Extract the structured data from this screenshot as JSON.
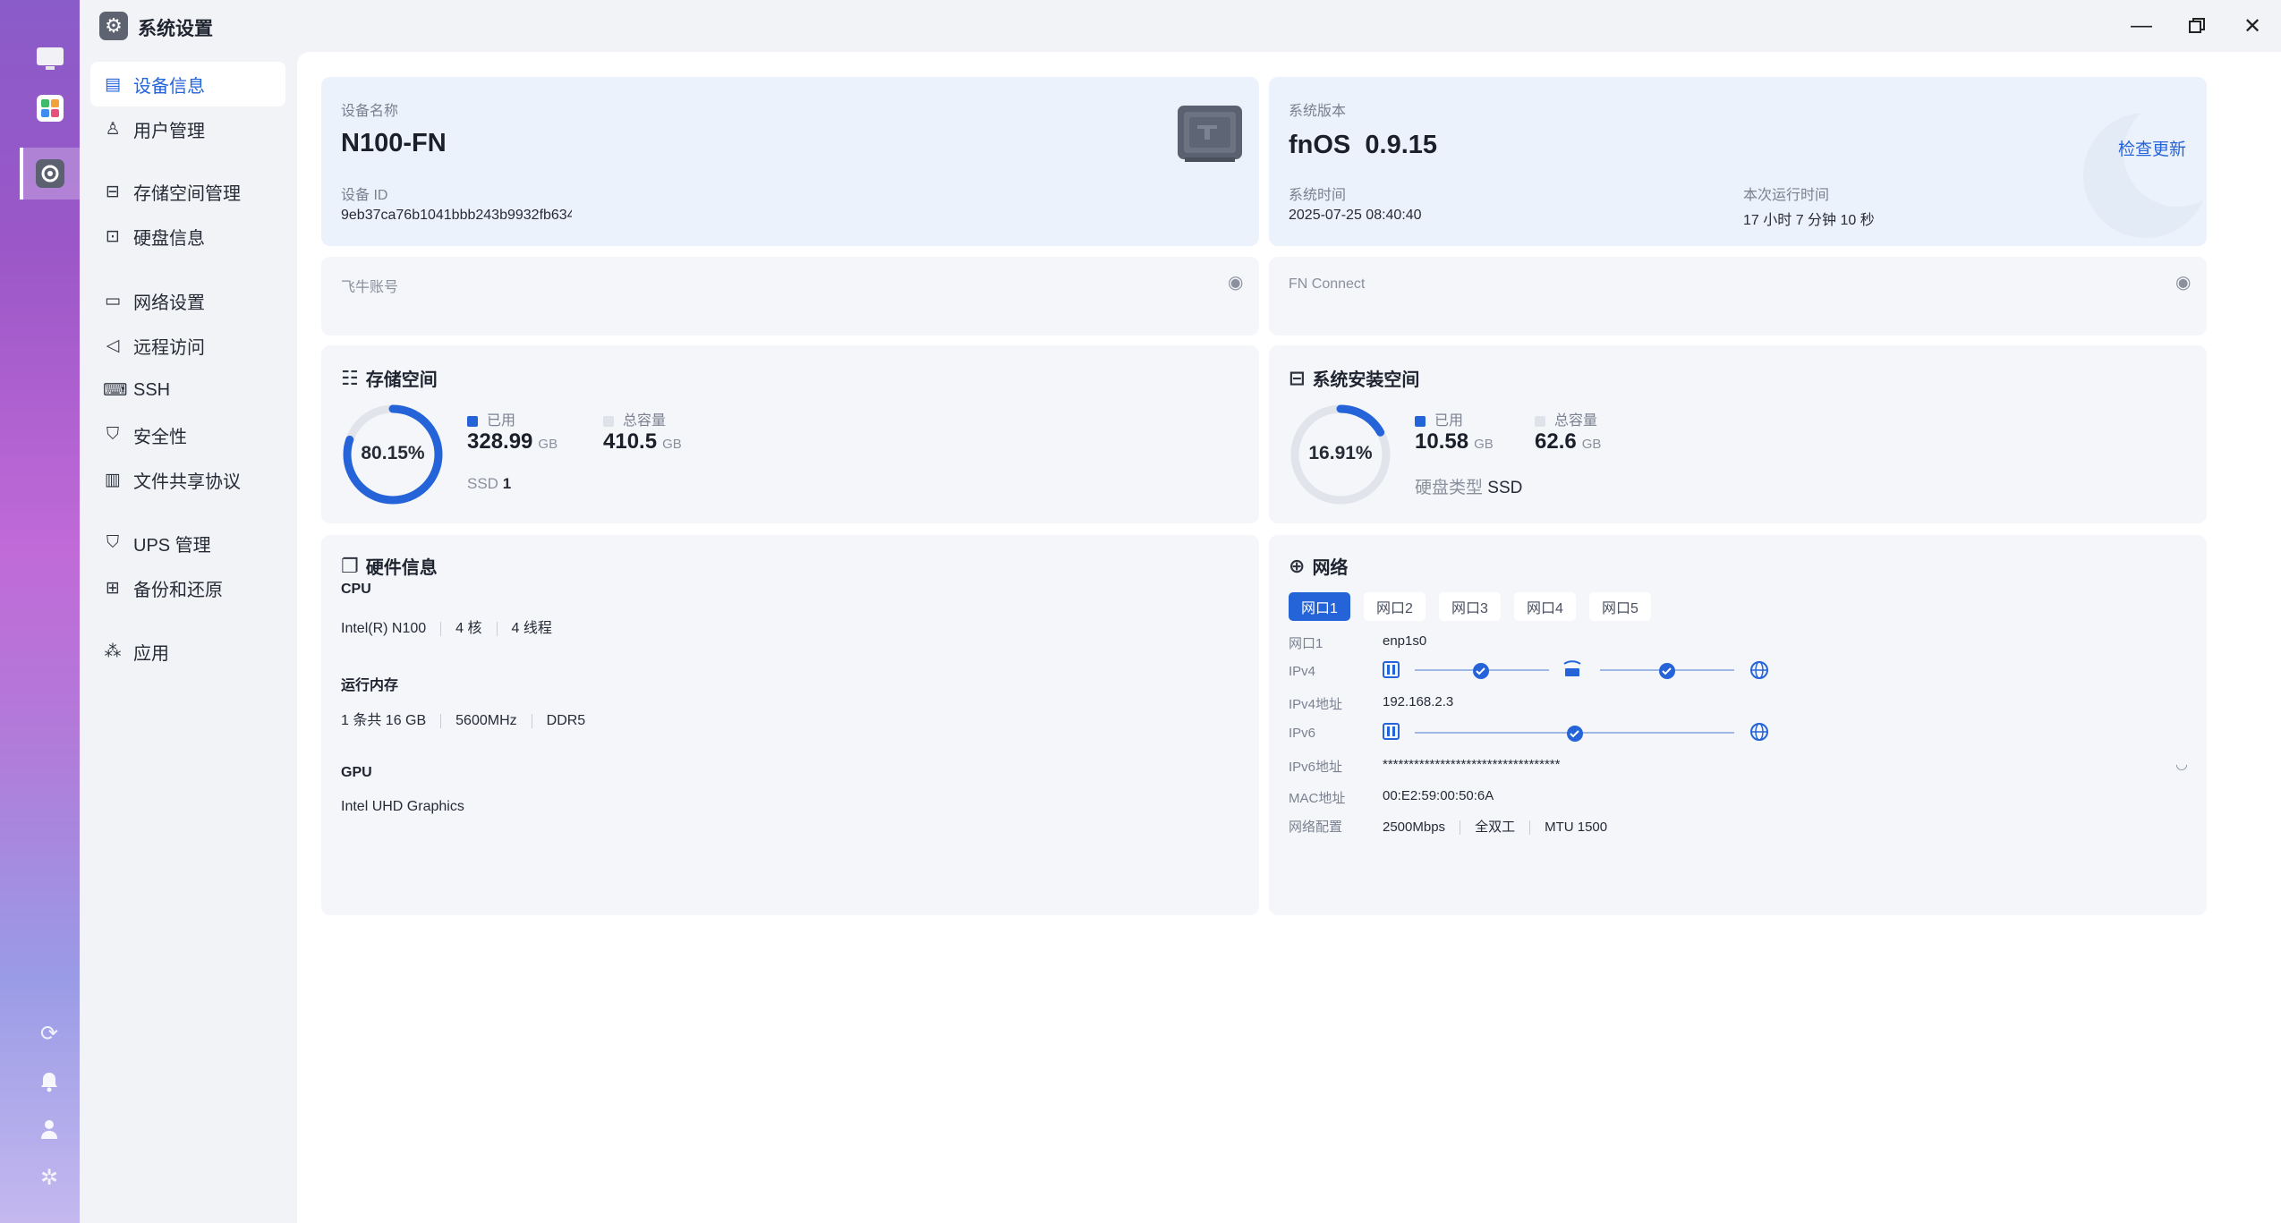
{
  "window": {
    "title": "系统设置"
  },
  "sidebar": {
    "items": [
      {
        "label": "设备信息"
      },
      {
        "label": "用户管理"
      },
      {
        "label": "存储空间管理"
      },
      {
        "label": "硬盘信息"
      },
      {
        "label": "网络设置"
      },
      {
        "label": "远程访问"
      },
      {
        "label": "SSH"
      },
      {
        "label": "安全性"
      },
      {
        "label": "文件共享协议"
      },
      {
        "label": "UPS 管理"
      },
      {
        "label": "备份和还原"
      },
      {
        "label": "应用"
      }
    ]
  },
  "device": {
    "name_label": "设备名称",
    "name": "N100-FN",
    "id_label": "设备 ID",
    "id": "9eb37ca76b1041bbb243b9932fb634"
  },
  "system": {
    "version_label": "系统版本",
    "os": "fnOS",
    "version": "0.9.15",
    "check_update": "检查更新",
    "time_label": "系统时间",
    "time": "2025-07-25 08:40:40",
    "uptime_label": "本次运行时间",
    "uptime": "17 小时 7 分钟 10 秒"
  },
  "accounts": {
    "feiniu_label": "飞牛账号",
    "fnconnect_label": "FN Connect"
  },
  "storage": {
    "title": "存储空间",
    "percent_text": "80.15%",
    "percent": 0.8015,
    "used_label": "已用",
    "used": "328.99",
    "total_label": "总容量",
    "total": "410.5",
    "unit": "GB",
    "disk_label": "SSD",
    "disk_count": "1"
  },
  "sysdisk": {
    "title": "系统安装空间",
    "percent_text": "16.91%",
    "percent": 0.1691,
    "used_label": "已用",
    "used": "10.58",
    "total_label": "总容量",
    "total": "62.6",
    "unit": "GB",
    "type_label": "硬盘类型",
    "type": "SSD"
  },
  "hardware": {
    "title": "硬件信息",
    "cpu_label": "CPU",
    "cpu_model": "Intel(R) N100",
    "cpu_cores": "4 核",
    "cpu_threads": "4 线程",
    "mem_label": "运行内存",
    "mem_size": "1 条共 16 GB",
    "mem_speed": "5600MHz",
    "mem_type": "DDR5",
    "gpu_label": "GPU",
    "gpu_model": "Intel UHD Graphics"
  },
  "network": {
    "title": "网络",
    "tabs": [
      {
        "label": "网口1"
      },
      {
        "label": "网口2"
      },
      {
        "label": "网口3"
      },
      {
        "label": "网口4"
      },
      {
        "label": "网口5"
      }
    ],
    "port_label": "网口1",
    "port": "enp1s0",
    "ipv4_label": "IPv4",
    "ipv4_addr_label": "IPv4地址",
    "ipv4_addr": "192.168.2.3",
    "ipv6_label": "IPv6",
    "ipv6_addr_label": "IPv6地址",
    "ipv6_addr": "**********************************",
    "mac_label": "MAC地址",
    "mac": "00:E2:59:00:50:6A",
    "config_label": "网络配置",
    "speed": "2500Mbps",
    "duplex": "全双工",
    "mtu": "MTU 1500"
  },
  "colors": {
    "accent": "#2563d9",
    "ring_track": "#e1e4ea",
    "card": "#f4f6fa"
  }
}
